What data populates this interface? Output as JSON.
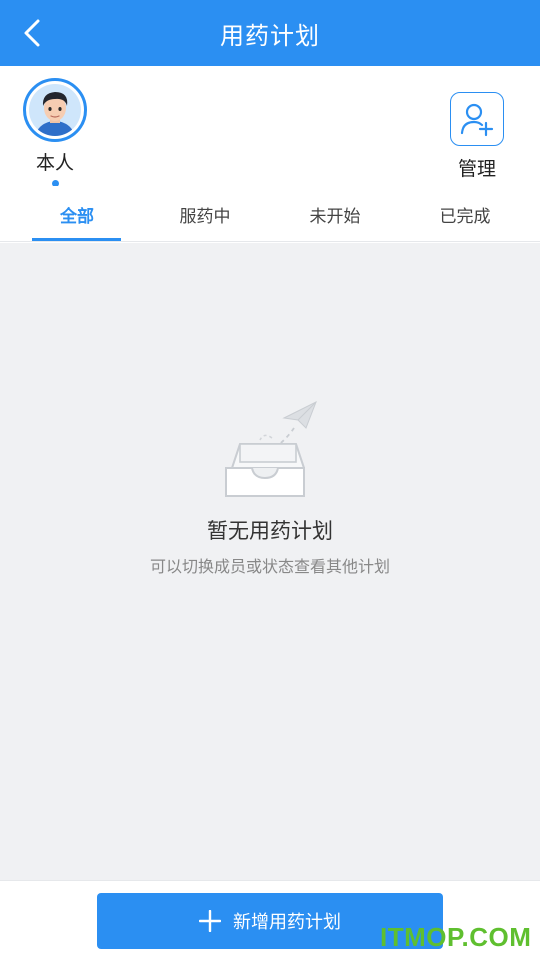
{
  "header": {
    "title": "用药计划",
    "back_icon": "chevron-left-icon"
  },
  "members": [
    {
      "name": "本人",
      "selected": true
    }
  ],
  "manage": {
    "label": "管理",
    "icon": "add-user-icon"
  },
  "tabs": [
    {
      "label": "全部",
      "active": true
    },
    {
      "label": "服药中",
      "active": false
    },
    {
      "label": "未开始",
      "active": false
    },
    {
      "label": "已完成",
      "active": false
    }
  ],
  "empty_state": {
    "title": "暂无用药计划",
    "subtitle": "可以切换成员或状态查看其他计划",
    "icon": "empty-inbox-paper-plane-icon"
  },
  "footer": {
    "add_button_label": "新增用药计划",
    "add_icon": "plus-icon"
  },
  "watermark": "ITMOP.COM",
  "colors": {
    "primary": "#2b8ff2",
    "background": "#f0f1f3",
    "watermark": "#5fbf2f"
  }
}
